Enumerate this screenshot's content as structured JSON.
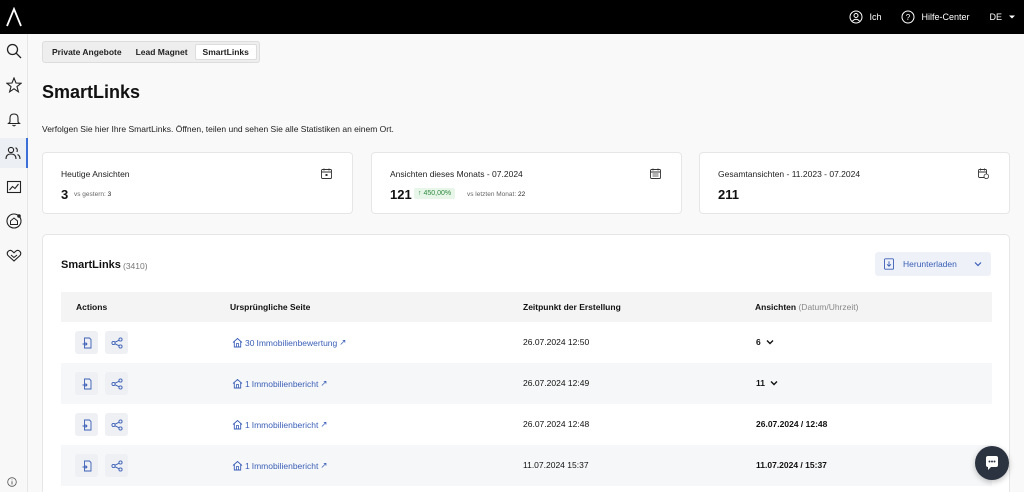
{
  "topbar": {
    "user_label": "Ich",
    "help_label": "Hilfe-Center",
    "lang_label": "DE"
  },
  "sidebar": {
    "items": [
      "search-icon",
      "star-icon",
      "bell-icon",
      "users-icon",
      "chart-icon",
      "home-badge-icon",
      "handshake-icon"
    ],
    "active_index": 3
  },
  "tabs": [
    {
      "label": "Private Angebote"
    },
    {
      "label": "Lead Magnet"
    },
    {
      "label": "SmartLinks"
    }
  ],
  "page": {
    "title": "SmartLinks",
    "description": "Verfolgen Sie hier Ihre SmartLinks. Öffnen, teilen und sehen Sie alle Statistiken an einem Ort."
  },
  "cards": [
    {
      "label": "Heutige Ansichten",
      "value": "3",
      "sub_prefix": "vs gestern:",
      "sub_value": "3"
    },
    {
      "label": "Ansichten dieses Monats - 07.2024",
      "value": "121",
      "badge": "↑ 450,00%",
      "sub_prefix": "vs letzten Monat:",
      "sub_value": "22"
    },
    {
      "label": "Gesamtansichten - 11.2023 - 07.2024",
      "value": "211"
    }
  ],
  "panel": {
    "title": "SmartLinks",
    "count": "(3410)",
    "download_label": "Herunterladen",
    "columns": {
      "actions": "Actions",
      "page": "Ursprüngliche Seite",
      "created": "Zeitpunkt der Erstellung",
      "views": "Ansichten",
      "views_hint": "(Datum/Uhrzeit)"
    },
    "rows": [
      {
        "link_num": "30",
        "link_label": "Immobilienbewertung",
        "created": "26.07.2024 12:50",
        "views": "6",
        "expandable": true
      },
      {
        "link_num": "1",
        "link_label": "Immobilienbericht",
        "created": "26.07.2024 12:49",
        "views": "11",
        "expandable": true
      },
      {
        "link_num": "1",
        "link_label": "Immobilienbericht",
        "created": "26.07.2024 12:48",
        "views": "26.07.2024 / 12:48",
        "expandable": false
      },
      {
        "link_num": "1",
        "link_label": "Immobilienbericht",
        "created": "11.07.2024 15:37",
        "views": "11.07.2024 / 15:37",
        "expandable": false
      }
    ]
  }
}
